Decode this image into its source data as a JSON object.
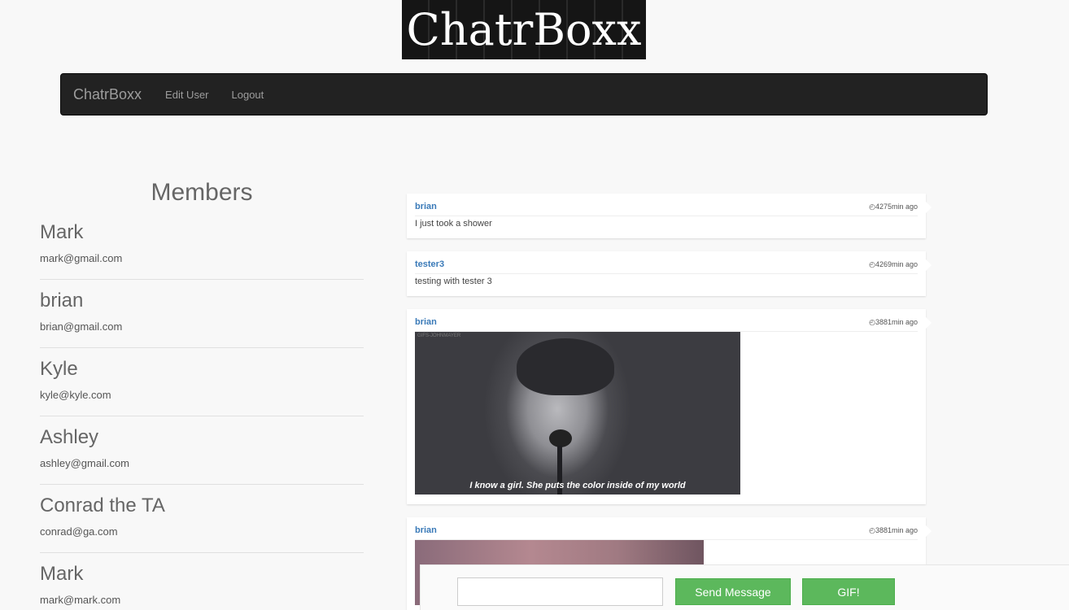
{
  "logo": {
    "text": "ChatrBoxx"
  },
  "nav": {
    "brand": "ChatrBoxx",
    "links": [
      "Edit User",
      "Logout"
    ]
  },
  "members": {
    "title": "Members",
    "list": [
      {
        "name": "Mark",
        "email": "mark@gmail.com"
      },
      {
        "name": "brian",
        "email": "brian@gmail.com"
      },
      {
        "name": "Kyle",
        "email": "kyle@kyle.com"
      },
      {
        "name": "Ashley",
        "email": "ashley@gmail.com"
      },
      {
        "name": "Conrad the TA",
        "email": "conrad@ga.com"
      },
      {
        "name": "Mark",
        "email": "mark@mark.com"
      }
    ]
  },
  "messages": [
    {
      "user": "brian",
      "time": "4275min ago",
      "text": "I just took a shower"
    },
    {
      "user": "tester3",
      "time": "4269min ago",
      "text": "testing with tester 3"
    },
    {
      "user": "brian",
      "time": "3881min ago",
      "gif_caption": "I know a girl. She puts the color inside of my world",
      "gif_watermark": "GIFS-JOHNMAYER"
    },
    {
      "user": "brian",
      "time": "3881min ago"
    }
  ],
  "composer": {
    "input_value": "",
    "input_placeholder": "",
    "send_label": "Send Message",
    "gif_label": "GIF!"
  },
  "colors": {
    "accent": "#5cb85c",
    "username": "#3a7ab8",
    "navbar": "#222222"
  }
}
